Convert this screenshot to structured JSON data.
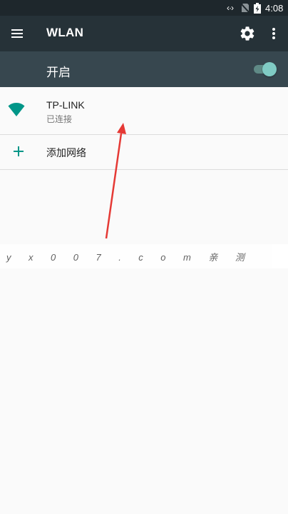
{
  "status_bar": {
    "data_icon": "data-transfer-icon",
    "sim_icon": "no-sim-icon",
    "battery_icon": "battery-charging-icon",
    "time": "4:08"
  },
  "toolbar": {
    "menu_icon": "hamburger-menu-icon",
    "title": "WLAN",
    "settings_icon": "gear-icon",
    "more_icon": "more-vert-icon"
  },
  "master_switch": {
    "label": "开启",
    "state": "on"
  },
  "networks": [
    {
      "ssid": "TP-LINK",
      "status": "已连接",
      "icon": "wifi-signal-icon"
    }
  ],
  "add_network": {
    "icon": "plus-icon",
    "label": "添加网络"
  },
  "watermark": {
    "text": "yx007.com亲测"
  },
  "colors": {
    "status_bar": "#1e272c",
    "toolbar": "#263238",
    "switch_bar": "#37474f",
    "accent": "#009688",
    "toggle_thumb": "#80cbc4",
    "annotation_arrow": "#e53935"
  }
}
